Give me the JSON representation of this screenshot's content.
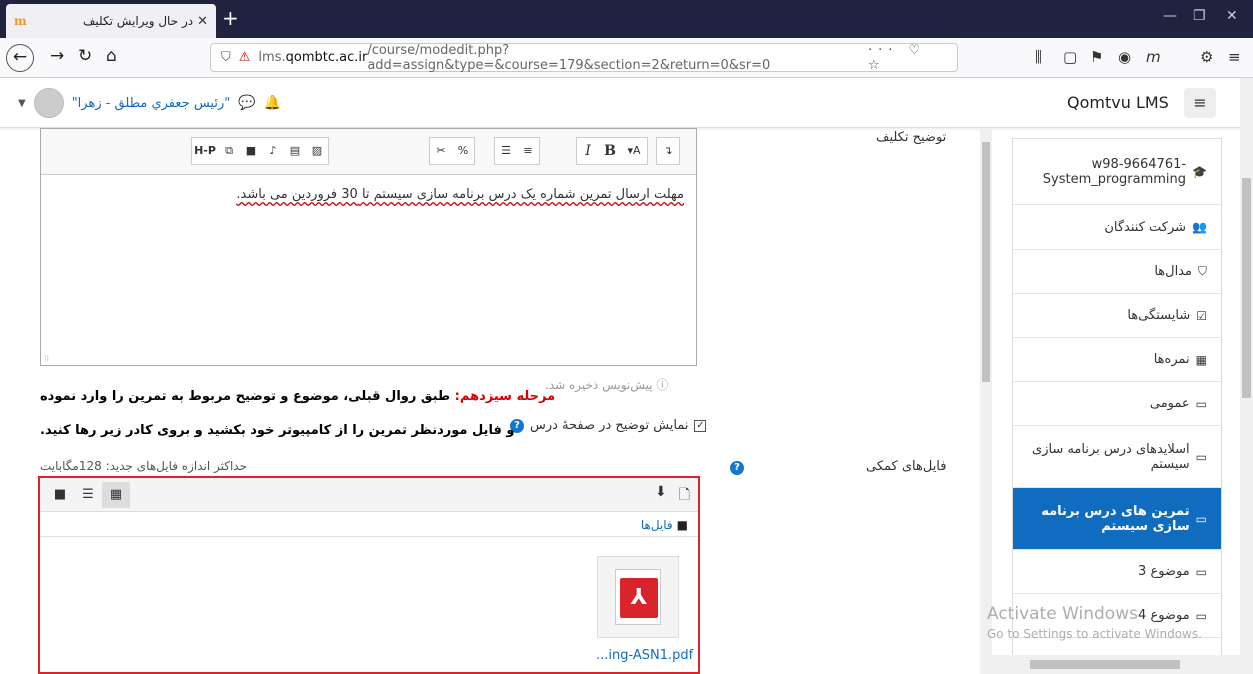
{
  "browser": {
    "tab_title": "در حال ویرایش تکلیف",
    "url_prefix": "lms.",
    "url_domain": "qombtc.ac.ir",
    "url_path": "/course/modedit.php?add=assign&type=&course=179&section=2&return=0&sr=0"
  },
  "header": {
    "brand": "Qomtvu LMS",
    "user_name": "\"رئیس جعفري مطلق - زهرا\""
  },
  "form": {
    "description_label": "توضیح تکلیف",
    "editor_text": "مهلت ارسال تمرین شماره یک درس برنامه سازی سیستم تا 30 فروردین می باشد.",
    "autosave_note": "پیش‌نویس ذخیره شد.",
    "show_description_label": "نمایش توضیح در صفحهٔ درس",
    "files_label": "فایل‌های کمکی",
    "max_size": "حداکثر اندازه فایل‌های جدید: 128مگابایت",
    "files_path": "فایل‌ها",
    "file_name": "...ing-ASN1.pdf"
  },
  "annotation": {
    "step_label": "مرحله سیزدهم:",
    "line1": " طبق روال قبلی، موضوع و توضیح مربوط به تمرین را وارد نموده",
    "line2": "و فایل موردنظر تمرین را از کامپیوتر خود بکشید و بروی کادر زیر رها کنید."
  },
  "sidebar": {
    "items": [
      {
        "label": "w98-9664761- System_programming",
        "icon": "graduation-cap-icon"
      },
      {
        "label": "شرکت کنندگان",
        "icon": "users-icon"
      },
      {
        "label": "مدال‌ها",
        "icon": "shield-icon"
      },
      {
        "label": "شایستگی‌ها",
        "icon": "checkbox-icon"
      },
      {
        "label": "نمره‌ها",
        "icon": "table-icon"
      },
      {
        "label": "عمومی",
        "icon": "folder-icon"
      },
      {
        "label": "اسلایدهای درس برنامه سازی سیستم",
        "icon": "folder-icon"
      },
      {
        "label": "تمرین های درس برنامه سازی سیستم",
        "icon": "folder-icon"
      },
      {
        "label": "موضوع 3",
        "icon": "folder-icon"
      },
      {
        "label": "موضوع 4",
        "icon": "folder-icon"
      }
    ]
  },
  "watermark": {
    "line1": "Activate Windows",
    "line2": "Go to Settings to activate Windows."
  }
}
